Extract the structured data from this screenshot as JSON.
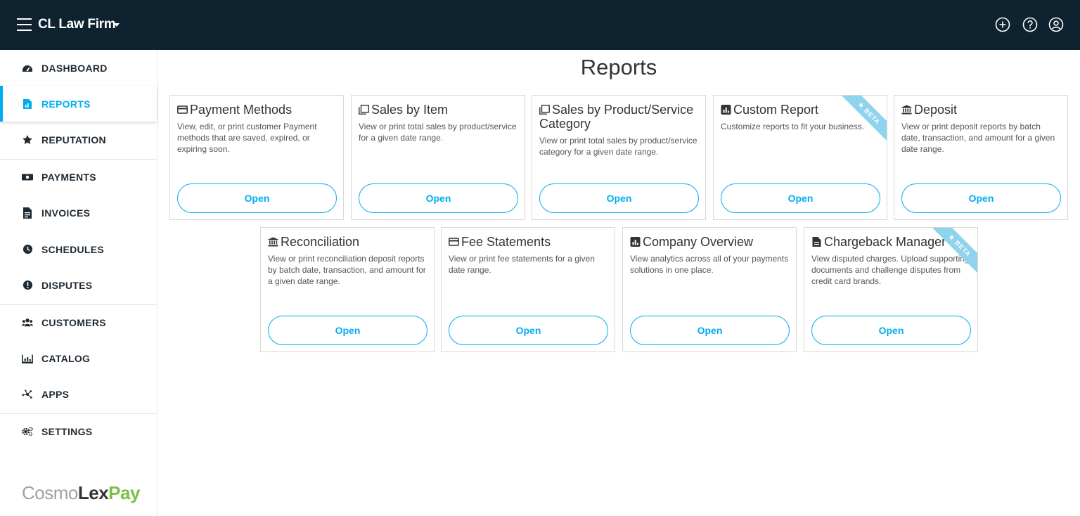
{
  "header": {
    "firm_name": "CL Law Firm",
    "icons": [
      "add-circle-icon",
      "help-circle-icon",
      "user-circle-icon"
    ]
  },
  "sidebar": {
    "items": [
      {
        "label": "DASHBOARD",
        "icon": "dashboard-gauge-icon"
      },
      {
        "label": "REPORTS",
        "icon": "report-document-icon",
        "active": true
      },
      {
        "label": "REPUTATION",
        "icon": "star-icon"
      },
      {
        "label": "PAYMENTS",
        "icon": "money-bill-icon"
      },
      {
        "label": "INVOICES",
        "icon": "invoice-icon"
      },
      {
        "label": "SCHEDULES",
        "icon": "clock-icon"
      },
      {
        "label": "DISPUTES",
        "icon": "alert-circle-icon"
      },
      {
        "label": "CUSTOMERS",
        "icon": "users-icon"
      },
      {
        "label": "CATALOG",
        "icon": "catalog-icon"
      },
      {
        "label": "APPS",
        "icon": "apps-network-icon"
      },
      {
        "label": "SETTINGS",
        "icon": "cogs-icon"
      }
    ],
    "logo": {
      "part1": "Cosmo",
      "part2": "Lex",
      "part3": "Pay"
    }
  },
  "main": {
    "title": "Reports",
    "open_label": "Open",
    "beta_label": "★ BETA",
    "cards": [
      {
        "title": "Payment Methods",
        "icon": "credit-card-icon",
        "desc": "View, edit, or print customer Payment methods that are saved, expired, or expiring soon."
      },
      {
        "title": "Sales by Item",
        "icon": "copy-icon",
        "desc": "View or print total sales by product/service for a given date range."
      },
      {
        "title": "Sales by Product/Service Category",
        "icon": "copy-icon",
        "desc": "View or print total sales by product/service category for a given date range."
      },
      {
        "title": "Custom Report",
        "icon": "chart-square-icon",
        "desc": "Customize reports to fit your business.",
        "beta": true
      },
      {
        "title": "Deposit",
        "icon": "bank-icon",
        "desc": "View or print deposit reports by batch date, transaction, and amount for a given date range."
      },
      {
        "title": "Reconciliation",
        "icon": "bank-icon",
        "desc": "View or print reconciliation deposit reports by batch date, transaction, and amount for a given date range."
      },
      {
        "title": "Fee Statements",
        "icon": "credit-card-icon",
        "desc": "View or print fee statements for a given date range."
      },
      {
        "title": "Company Overview",
        "icon": "chart-square-icon",
        "desc": "View analytics across all of your payments solutions in one place."
      },
      {
        "title": "Chargeback Manager",
        "icon": "file-icon",
        "desc": "View disputed charges. Upload supporting documents and challenge disputes from credit card brands.",
        "beta": true
      }
    ]
  },
  "colors": {
    "topbar": "#0e2230",
    "accent": "#00aeef",
    "beta": "#8fd4ec",
    "logo_green": "#7bc043"
  }
}
